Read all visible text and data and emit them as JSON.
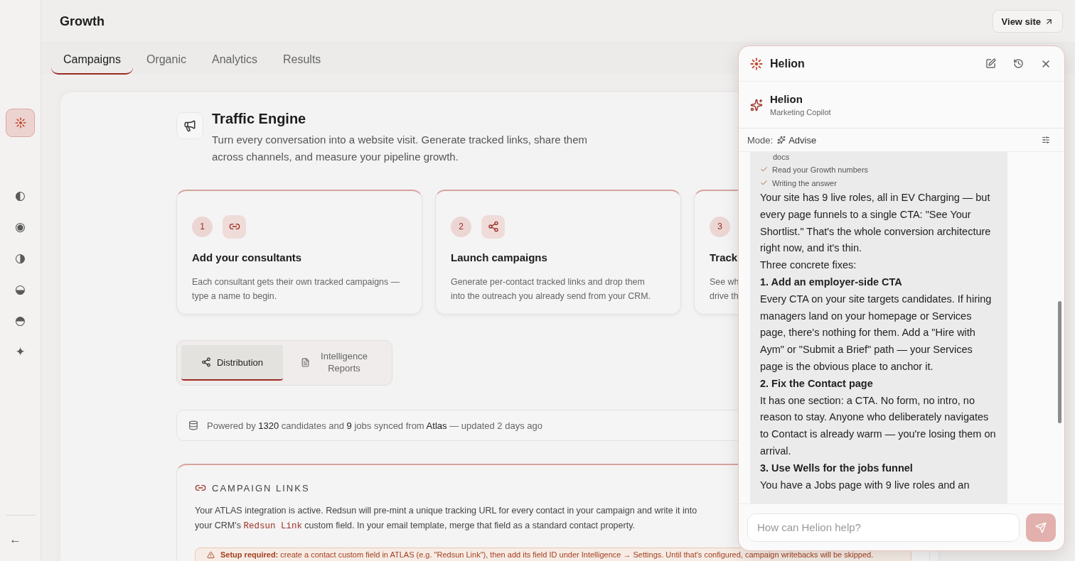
{
  "sidebar": {
    "items": [
      {
        "kind": "logo",
        "selected": true
      },
      {
        "kind": "glyph",
        "glyph": "◐",
        "selected": false
      },
      {
        "kind": "glyph",
        "glyph": "◉",
        "selected": false
      },
      {
        "kind": "glyph",
        "glyph": "◑",
        "selected": false
      },
      {
        "kind": "glyph",
        "glyph": "◒",
        "selected": false
      },
      {
        "kind": "glyph",
        "glyph": "◓",
        "selected": false
      },
      {
        "kind": "glyph",
        "glyph": "✦",
        "selected": false
      }
    ],
    "back": "←"
  },
  "header": {
    "title": "Growth",
    "button": "View site"
  },
  "tabs": [
    {
      "label": "Campaigns",
      "selected": true
    },
    {
      "label": "Organic",
      "selected": false
    },
    {
      "label": "Analytics",
      "selected": false
    },
    {
      "label": "Results",
      "selected": false
    }
  ],
  "hero": {
    "title": "Traffic Engine",
    "subtitle": "Turn every conversation into a website visit. Generate tracked links, share them across channels, and measure your pipeline growth."
  },
  "steps": [
    {
      "number": "1",
      "title": "Add your consultants",
      "lines": [
        "Each consultant gets their own tracked campaigns —",
        "type a name to begin."
      ]
    },
    {
      "number": "2",
      "title": "Launch campaigns",
      "lines": [
        "Generate per-contact tracked links and drop them",
        "into the outreach you already send from your CRM."
      ]
    },
    {
      "number": "3",
      "title": "Track",
      "lines": [
        "See wh",
        "drive th"
      ]
    }
  ],
  "view_toggle": [
    {
      "label": "Distribution",
      "selected": true
    },
    {
      "label": "Intelligence Reports",
      "selected": false
    }
  ],
  "powered_by": [
    {
      "text": "Powered by ",
      "strong": false
    },
    {
      "text": "1320",
      "strong": true
    },
    {
      "text": " candidates and ",
      "strong": false
    },
    {
      "text": "9",
      "strong": true
    },
    {
      "text": " jobs synced from ",
      "strong": false
    },
    {
      "text": "Atlas",
      "strong": true
    },
    {
      "text": " — updated 2 days ago",
      "strong": false
    }
  ],
  "campaign_links": {
    "title": "CAMPAIGN LINKS",
    "body": [
      {
        "kind": "text",
        "text": "Your ATLAS integration is active. Redsun will pre-mint a unique tracking URL for every contact in your campaign and write it into your CRM's "
      },
      {
        "kind": "code",
        "text": "Redsun Link"
      },
      {
        "kind": "text",
        "text": " custom field. In your email template, merge that field as a standard contact property."
      }
    ],
    "warning": "**Setup required:** create a contact custom field in ATLAS (e.g. \"Redsun Link\"), then add its field ID under Intelligence → Settings. Until that's configured, campaign writebacks will be skipped."
  },
  "assistant": {
    "title": "Helion",
    "agent_name": "Helion",
    "agent_role": "Marketing Copilot",
    "mode_label": "Mode:",
    "mode": "Advise",
    "messages": [
      {
        "kind": "continuation",
        "text": "docs"
      },
      {
        "kind": "step",
        "text": "Read your Growth numbers",
        "done": true
      },
      {
        "kind": "step",
        "text": "Writing the answer",
        "done": true
      },
      {
        "kind": "text",
        "text": "Your site has 9 live roles, all in EV Charging — but every page funnels to a single CTA: \"See Your Shortlist.\" That's the whole conversion architecture right now, and it's thin."
      },
      {
        "kind": "text",
        "text": "Three concrete fixes:"
      },
      {
        "kind": "heading",
        "text": "1. Add an employer-side CTA"
      },
      {
        "kind": "text",
        "text": "Every CTA on your site targets candidates. If hiring managers land on your homepage or Services page, there's nothing for them. Add a \"Hire with Aym\" or \"Submit a Brief\" path — your Services page is the obvious place to anchor it."
      },
      {
        "kind": "heading",
        "text": "2. Fix the Contact page"
      },
      {
        "kind": "text",
        "text": "It has one section: a CTA. No form, no intro, no reason to stay. Anyone who deliberately navigates to Contact is already warm — you're losing them on arrival."
      },
      {
        "kind": "heading",
        "text": "3. Use Wells for the jobs funnel"
      },
      {
        "kind": "text",
        "text": "You have a Jobs page with 9 live roles and an"
      }
    ],
    "input_placeholder": "How can Helion help?"
  }
}
